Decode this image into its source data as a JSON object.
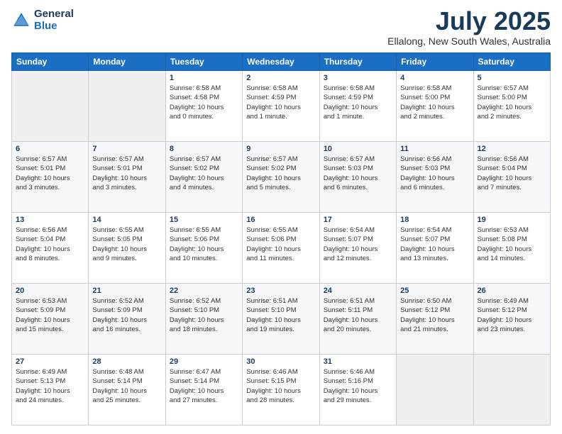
{
  "logo": {
    "line1": "General",
    "line2": "Blue"
  },
  "title": "July 2025",
  "location": "Ellalong, New South Wales, Australia",
  "weekdays": [
    "Sunday",
    "Monday",
    "Tuesday",
    "Wednesday",
    "Thursday",
    "Friday",
    "Saturday"
  ],
  "weeks": [
    [
      {
        "day": "",
        "info": ""
      },
      {
        "day": "",
        "info": ""
      },
      {
        "day": "1",
        "info": "Sunrise: 6:58 AM\nSunset: 4:58 PM\nDaylight: 10 hours\nand 0 minutes."
      },
      {
        "day": "2",
        "info": "Sunrise: 6:58 AM\nSunset: 4:59 PM\nDaylight: 10 hours\nand 1 minute."
      },
      {
        "day": "3",
        "info": "Sunrise: 6:58 AM\nSunset: 4:59 PM\nDaylight: 10 hours\nand 1 minute."
      },
      {
        "day": "4",
        "info": "Sunrise: 6:58 AM\nSunset: 5:00 PM\nDaylight: 10 hours\nand 2 minutes."
      },
      {
        "day": "5",
        "info": "Sunrise: 6:57 AM\nSunset: 5:00 PM\nDaylight: 10 hours\nand 2 minutes."
      }
    ],
    [
      {
        "day": "6",
        "info": "Sunrise: 6:57 AM\nSunset: 5:01 PM\nDaylight: 10 hours\nand 3 minutes."
      },
      {
        "day": "7",
        "info": "Sunrise: 6:57 AM\nSunset: 5:01 PM\nDaylight: 10 hours\nand 3 minutes."
      },
      {
        "day": "8",
        "info": "Sunrise: 6:57 AM\nSunset: 5:02 PM\nDaylight: 10 hours\nand 4 minutes."
      },
      {
        "day": "9",
        "info": "Sunrise: 6:57 AM\nSunset: 5:02 PM\nDaylight: 10 hours\nand 5 minutes."
      },
      {
        "day": "10",
        "info": "Sunrise: 6:57 AM\nSunset: 5:03 PM\nDaylight: 10 hours\nand 6 minutes."
      },
      {
        "day": "11",
        "info": "Sunrise: 6:56 AM\nSunset: 5:03 PM\nDaylight: 10 hours\nand 6 minutes."
      },
      {
        "day": "12",
        "info": "Sunrise: 6:56 AM\nSunset: 5:04 PM\nDaylight: 10 hours\nand 7 minutes."
      }
    ],
    [
      {
        "day": "13",
        "info": "Sunrise: 6:56 AM\nSunset: 5:04 PM\nDaylight: 10 hours\nand 8 minutes."
      },
      {
        "day": "14",
        "info": "Sunrise: 6:55 AM\nSunset: 5:05 PM\nDaylight: 10 hours\nand 9 minutes."
      },
      {
        "day": "15",
        "info": "Sunrise: 6:55 AM\nSunset: 5:06 PM\nDaylight: 10 hours\nand 10 minutes."
      },
      {
        "day": "16",
        "info": "Sunrise: 6:55 AM\nSunset: 5:06 PM\nDaylight: 10 hours\nand 11 minutes."
      },
      {
        "day": "17",
        "info": "Sunrise: 6:54 AM\nSunset: 5:07 PM\nDaylight: 10 hours\nand 12 minutes."
      },
      {
        "day": "18",
        "info": "Sunrise: 6:54 AM\nSunset: 5:07 PM\nDaylight: 10 hours\nand 13 minutes."
      },
      {
        "day": "19",
        "info": "Sunrise: 6:53 AM\nSunset: 5:08 PM\nDaylight: 10 hours\nand 14 minutes."
      }
    ],
    [
      {
        "day": "20",
        "info": "Sunrise: 6:53 AM\nSunset: 5:09 PM\nDaylight: 10 hours\nand 15 minutes."
      },
      {
        "day": "21",
        "info": "Sunrise: 6:52 AM\nSunset: 5:09 PM\nDaylight: 10 hours\nand 16 minutes."
      },
      {
        "day": "22",
        "info": "Sunrise: 6:52 AM\nSunset: 5:10 PM\nDaylight: 10 hours\nand 18 minutes."
      },
      {
        "day": "23",
        "info": "Sunrise: 6:51 AM\nSunset: 5:10 PM\nDaylight: 10 hours\nand 19 minutes."
      },
      {
        "day": "24",
        "info": "Sunrise: 6:51 AM\nSunset: 5:11 PM\nDaylight: 10 hours\nand 20 minutes."
      },
      {
        "day": "25",
        "info": "Sunrise: 6:50 AM\nSunset: 5:12 PM\nDaylight: 10 hours\nand 21 minutes."
      },
      {
        "day": "26",
        "info": "Sunrise: 6:49 AM\nSunset: 5:12 PM\nDaylight: 10 hours\nand 23 minutes."
      }
    ],
    [
      {
        "day": "27",
        "info": "Sunrise: 6:49 AM\nSunset: 5:13 PM\nDaylight: 10 hours\nand 24 minutes."
      },
      {
        "day": "28",
        "info": "Sunrise: 6:48 AM\nSunset: 5:14 PM\nDaylight: 10 hours\nand 25 minutes."
      },
      {
        "day": "29",
        "info": "Sunrise: 6:47 AM\nSunset: 5:14 PM\nDaylight: 10 hours\nand 27 minutes."
      },
      {
        "day": "30",
        "info": "Sunrise: 6:46 AM\nSunset: 5:15 PM\nDaylight: 10 hours\nand 28 minutes."
      },
      {
        "day": "31",
        "info": "Sunrise: 6:46 AM\nSunset: 5:16 PM\nDaylight: 10 hours\nand 29 minutes."
      },
      {
        "day": "",
        "info": ""
      },
      {
        "day": "",
        "info": ""
      }
    ]
  ]
}
